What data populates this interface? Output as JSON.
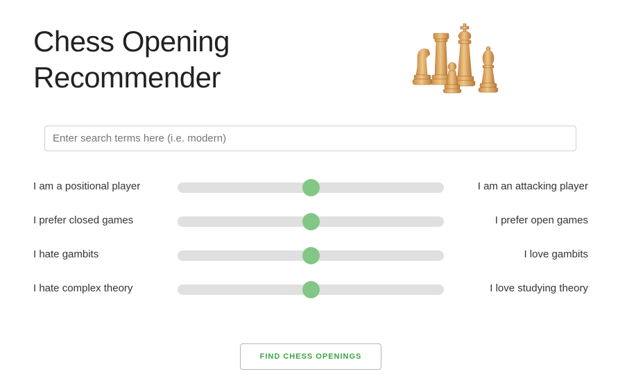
{
  "header": {
    "title_line1": "Chess Opening",
    "title_line2": "Recommender",
    "logo_icon": "chess-pieces-icon"
  },
  "search": {
    "placeholder": "Enter search terms here (i.e. modern)",
    "value": ""
  },
  "sliders": [
    {
      "left_label": "I am a positional player",
      "right_label": "I am an attacking player",
      "value": 0.5
    },
    {
      "left_label": "I prefer closed games",
      "right_label": "I prefer open games",
      "value": 0.5
    },
    {
      "left_label": "I hate gambits",
      "right_label": "I love gambits",
      "value": 0.5
    },
    {
      "left_label": "I hate complex theory",
      "right_label": "I love studying theory",
      "value": 0.5
    }
  ],
  "button": {
    "label": "FIND CHESS OPENINGS"
  },
  "colors": {
    "accent": "#82c785",
    "track": "#e0e0e0",
    "button_text": "#3aa53e",
    "piece": "#d9a05b"
  }
}
